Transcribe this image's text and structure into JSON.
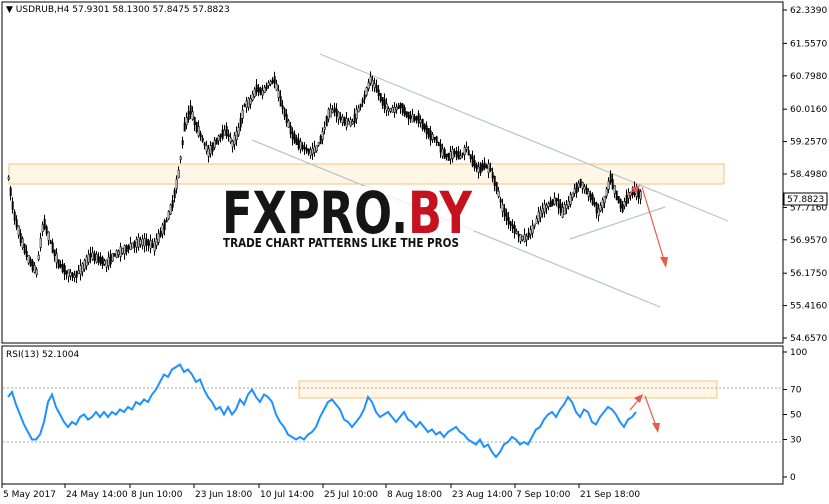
{
  "chart_data": [
    {
      "type": "candlestick",
      "header": {
        "symbol": "USDRUB,H4",
        "ohlc": "57.9301 58.1300 57.8475 57.8823"
      },
      "y_ticks": [
        "62.3390",
        "61.5570",
        "60.7980",
        "60.0160",
        "59.2570",
        "58.4980",
        "57.7160",
        "56.9570",
        "56.1750",
        "55.4160",
        "54.6570"
      ],
      "ylim": [
        54.657,
        62.339
      ],
      "current_price": "57.8823",
      "x_ticks": [
        "5 May 2017",
        "24 May 14:00",
        "8 Jun 10:00",
        "23 Jun 18:00",
        "10 Jul 14:00",
        "25 Jul 10:00",
        "8 Aug 18:00",
        "23 Aug 14:00",
        "7 Sep 10:00",
        "21 Sep 18:00"
      ],
      "price_path": [
        [
          0,
          58.4
        ],
        [
          5,
          57.6
        ],
        [
          12,
          57.0
        ],
        [
          20,
          56.5
        ],
        [
          28,
          56.2
        ],
        [
          35,
          57.4
        ],
        [
          42,
          56.9
        ],
        [
          50,
          56.4
        ],
        [
          58,
          56.2
        ],
        [
          66,
          56.1
        ],
        [
          74,
          56.3
        ],
        [
          82,
          56.6
        ],
        [
          90,
          56.5
        ],
        [
          98,
          56.4
        ],
        [
          106,
          56.6
        ],
        [
          114,
          56.7
        ],
        [
          122,
          56.8
        ],
        [
          130,
          56.9
        ],
        [
          138,
          56.9
        ],
        [
          146,
          56.8
        ],
        [
          152,
          57.1
        ],
        [
          158,
          57.4
        ],
        [
          164,
          57.8
        ],
        [
          170,
          58.5
        ],
        [
          176,
          59.6
        ],
        [
          182,
          60.0
        ],
        [
          188,
          59.6
        ],
        [
          194,
          59.3
        ],
        [
          200,
          59.0
        ],
        [
          206,
          59.2
        ],
        [
          212,
          59.4
        ],
        [
          218,
          59.5
        ],
        [
          224,
          59.2
        ],
        [
          230,
          59.5
        ],
        [
          236,
          60.1
        ],
        [
          242,
          60.2
        ],
        [
          248,
          60.5
        ],
        [
          254,
          60.4
        ],
        [
          260,
          60.6
        ],
        [
          266,
          60.7
        ],
        [
          272,
          60.2
        ],
        [
          278,
          59.8
        ],
        [
          284,
          59.4
        ],
        [
          290,
          59.2
        ],
        [
          296,
          59.1
        ],
        [
          302,
          59.0
        ],
        [
          308,
          59.1
        ],
        [
          314,
          59.4
        ],
        [
          320,
          59.9
        ],
        [
          326,
          60.0
        ],
        [
          332,
          59.8
        ],
        [
          338,
          59.7
        ],
        [
          344,
          59.7
        ],
        [
          350,
          60.0
        ],
        [
          356,
          60.3
        ],
        [
          362,
          60.7
        ],
        [
          368,
          60.5
        ],
        [
          374,
          60.2
        ],
        [
          380,
          60.0
        ],
        [
          386,
          60.0
        ],
        [
          392,
          60.1
        ],
        [
          398,
          59.9
        ],
        [
          404,
          59.8
        ],
        [
          410,
          59.8
        ],
        [
          416,
          59.6
        ],
        [
          422,
          59.4
        ],
        [
          428,
          59.3
        ],
        [
          434,
          59.0
        ],
        [
          440,
          58.9
        ],
        [
          446,
          59.0
        ],
        [
          452,
          58.9
        ],
        [
          458,
          59.1
        ],
        [
          464,
          58.8
        ],
        [
          470,
          58.6
        ],
        [
          476,
          58.7
        ],
        [
          482,
          58.6
        ],
        [
          488,
          58.2
        ],
        [
          494,
          57.7
        ],
        [
          500,
          57.4
        ],
        [
          506,
          57.2
        ],
        [
          512,
          57.0
        ],
        [
          518,
          57.0
        ],
        [
          524,
          57.2
        ],
        [
          530,
          57.5
        ],
        [
          536,
          57.7
        ],
        [
          542,
          57.8
        ],
        [
          548,
          57.9
        ],
        [
          554,
          57.6
        ],
        [
          560,
          57.8
        ],
        [
          566,
          58.1
        ],
        [
          572,
          58.3
        ],
        [
          578,
          58.1
        ],
        [
          584,
          57.9
        ],
        [
          590,
          57.6
        ],
        [
          596,
          57.9
        ],
        [
          602,
          58.4
        ],
        [
          608,
          58.0
        ],
        [
          614,
          57.7
        ],
        [
          620,
          58.0
        ],
        [
          626,
          58.1
        ],
        [
          632,
          58.0
        ]
      ],
      "annotations": [
        "resistance zone 58.4-58.8",
        "descending channel",
        "bearish arrow toward 56.4"
      ]
    },
    {
      "type": "line",
      "header": "RSI(13) 52.1004",
      "y_ticks": [
        "100",
        "70",
        "50",
        "30",
        "0"
      ],
      "ylim": [
        0,
        100
      ],
      "x_ticks": [
        "5 May 2017",
        "24 May 14:00",
        "8 Jun 10:00",
        "23 Jun 18:00",
        "10 Jul 14:00",
        "25 Jul 10:00",
        "8 Aug 18:00",
        "23 Aug 14:00",
        "7 Sep 10:00",
        "21 Sep 18:00"
      ],
      "rsi_path": [
        [
          0,
          64
        ],
        [
          4,
          68
        ],
        [
          8,
          58
        ],
        [
          12,
          50
        ],
        [
          16,
          42
        ],
        [
          20,
          36
        ],
        [
          24,
          30
        ],
        [
          28,
          30
        ],
        [
          32,
          34
        ],
        [
          36,
          44
        ],
        [
          40,
          60
        ],
        [
          44,
          66
        ],
        [
          48,
          56
        ],
        [
          52,
          50
        ],
        [
          56,
          44
        ],
        [
          60,
          40
        ],
        [
          64,
          44
        ],
        [
          68,
          42
        ],
        [
          72,
          48
        ],
        [
          76,
          50
        ],
        [
          80,
          46
        ],
        [
          84,
          48
        ],
        [
          88,
          52
        ],
        [
          92,
          48
        ],
        [
          96,
          52
        ],
        [
          100,
          48
        ],
        [
          104,
          52
        ],
        [
          108,
          50
        ],
        [
          112,
          54
        ],
        [
          116,
          52
        ],
        [
          120,
          56
        ],
        [
          124,
          54
        ],
        [
          128,
          60
        ],
        [
          132,
          58
        ],
        [
          136,
          62
        ],
        [
          140,
          60
        ],
        [
          144,
          66
        ],
        [
          148,
          70
        ],
        [
          152,
          76
        ],
        [
          156,
          82
        ],
        [
          160,
          80
        ],
        [
          164,
          86
        ],
        [
          168,
          88
        ],
        [
          172,
          90
        ],
        [
          176,
          84
        ],
        [
          180,
          86
        ],
        [
          184,
          82
        ],
        [
          188,
          76
        ],
        [
          192,
          78
        ],
        [
          196,
          70
        ],
        [
          200,
          64
        ],
        [
          204,
          60
        ],
        [
          208,
          54
        ],
        [
          212,
          56
        ],
        [
          216,
          50
        ],
        [
          220,
          56
        ],
        [
          224,
          50
        ],
        [
          228,
          54
        ],
        [
          232,
          62
        ],
        [
          236,
          58
        ],
        [
          240,
          66
        ],
        [
          244,
          70
        ],
        [
          248,
          64
        ],
        [
          252,
          60
        ],
        [
          256,
          66
        ],
        [
          260,
          64
        ],
        [
          264,
          60
        ],
        [
          268,
          50
        ],
        [
          272,
          44
        ],
        [
          276,
          40
        ],
        [
          280,
          34
        ],
        [
          284,
          32
        ],
        [
          288,
          30
        ],
        [
          292,
          32
        ],
        [
          296,
          30
        ],
        [
          300,
          34
        ],
        [
          304,
          36
        ],
        [
          308,
          40
        ],
        [
          312,
          48
        ],
        [
          316,
          54
        ],
        [
          320,
          60
        ],
        [
          324,
          62
        ],
        [
          328,
          58
        ],
        [
          332,
          54
        ],
        [
          336,
          46
        ],
        [
          340,
          44
        ],
        [
          344,
          40
        ],
        [
          348,
          44
        ],
        [
          352,
          48
        ],
        [
          356,
          54
        ],
        [
          360,
          64
        ],
        [
          364,
          60
        ],
        [
          368,
          52
        ],
        [
          372,
          48
        ],
        [
          376,
          50
        ],
        [
          380,
          52
        ],
        [
          384,
          48
        ],
        [
          388,
          44
        ],
        [
          392,
          48
        ],
        [
          396,
          52
        ],
        [
          400,
          46
        ],
        [
          404,
          44
        ],
        [
          408,
          40
        ],
        [
          412,
          44
        ],
        [
          416,
          40
        ],
        [
          420,
          36
        ],
        [
          424,
          38
        ],
        [
          428,
          34
        ],
        [
          432,
          36
        ],
        [
          436,
          32
        ],
        [
          440,
          36
        ],
        [
          444,
          38
        ],
        [
          448,
          40
        ],
        [
          452,
          36
        ],
        [
          456,
          34
        ],
        [
          460,
          30
        ],
        [
          464,
          28
        ],
        [
          468,
          26
        ],
        [
          472,
          30
        ],
        [
          476,
          24
        ],
        [
          480,
          26
        ],
        [
          484,
          20
        ],
        [
          488,
          16
        ],
        [
          492,
          20
        ],
        [
          496,
          26
        ],
        [
          500,
          28
        ],
        [
          504,
          32
        ],
        [
          508,
          30
        ],
        [
          512,
          26
        ],
        [
          516,
          28
        ],
        [
          520,
          26
        ],
        [
          524,
          32
        ],
        [
          528,
          38
        ],
        [
          532,
          40
        ],
        [
          536,
          46
        ],
        [
          540,
          50
        ],
        [
          544,
          52
        ],
        [
          548,
          48
        ],
        [
          552,
          54
        ],
        [
          556,
          58
        ],
        [
          560,
          64
        ],
        [
          564,
          60
        ],
        [
          568,
          52
        ],
        [
          572,
          48
        ],
        [
          576,
          54
        ],
        [
          580,
          52
        ],
        [
          584,
          44
        ],
        [
          588,
          42
        ],
        [
          592,
          48
        ],
        [
          596,
          52
        ],
        [
          600,
          56
        ],
        [
          604,
          54
        ],
        [
          608,
          50
        ],
        [
          612,
          44
        ],
        [
          616,
          40
        ],
        [
          620,
          46
        ],
        [
          624,
          48
        ],
        [
          628,
          52
        ]
      ],
      "annotations": [
        "overbought zone 61-70",
        "bearish arrow toward 45"
      ]
    }
  ],
  "watermark": {
    "title_left": "FXPRO.",
    "title_right": "BY",
    "tagline": "TRADE CHART PATTERNS LIKE THE PROS"
  },
  "colors": {
    "candle": "#000000",
    "rsi_line": "#1e90ff",
    "channel": "#b8c4d2",
    "zone_fill": "#fff6e6",
    "zone_stroke": "#f5c27a",
    "arrow": "#e85b4a",
    "wm_red": "#c4121e",
    "wm_dark": "#151515"
  }
}
